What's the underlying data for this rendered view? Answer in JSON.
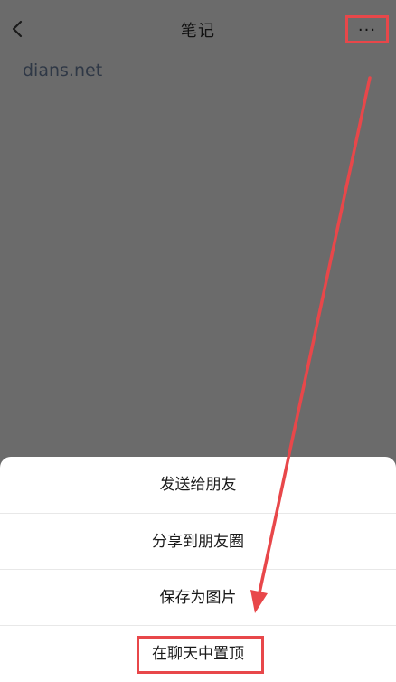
{
  "header": {
    "title": "笔记",
    "back_icon": "chevron-left-icon",
    "more_icon": "ellipsis-icon",
    "more_glyph": "···"
  },
  "note": {
    "content": "dians.net"
  },
  "action_sheet": {
    "items": [
      {
        "label": "发送给朋友"
      },
      {
        "label": "分享到朋友圈"
      },
      {
        "label": "保存为图片"
      },
      {
        "label": "在聊天中置顶"
      }
    ]
  },
  "annotation": {
    "highlight_color": "#e8474a",
    "overlay_color": "#6b6b6b"
  }
}
